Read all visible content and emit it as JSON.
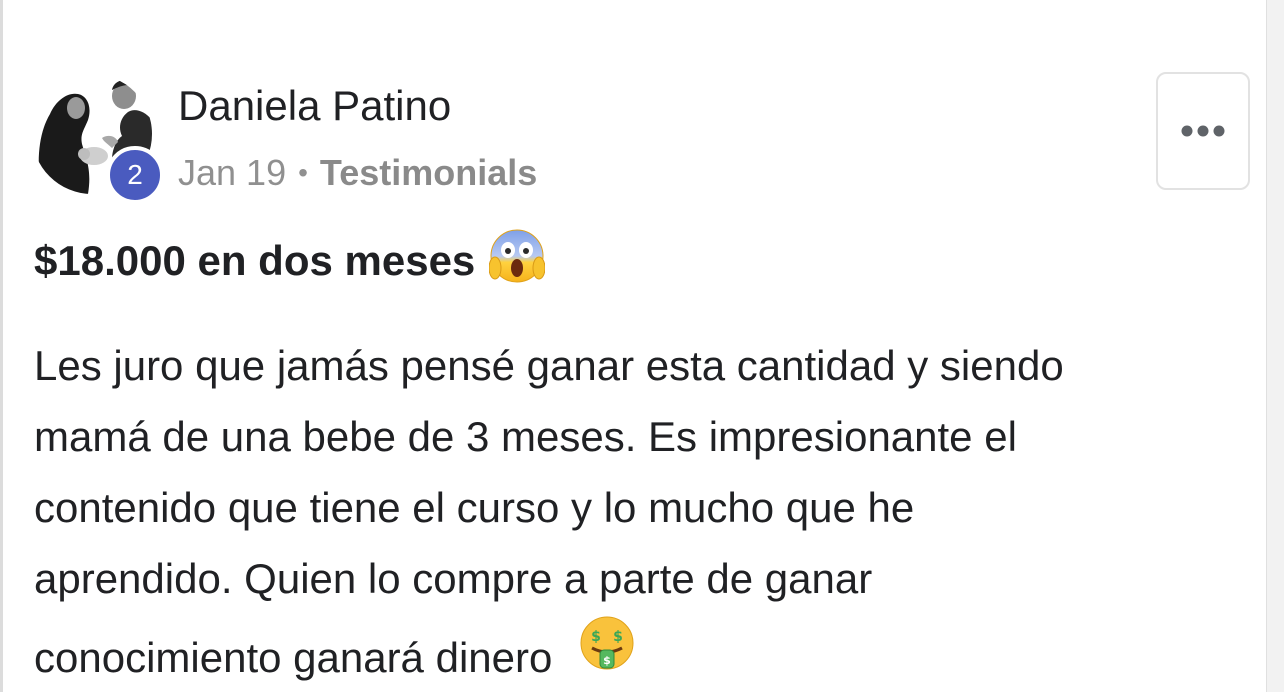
{
  "post": {
    "author": {
      "name": "Daniela Patino",
      "level": "2"
    },
    "meta": {
      "date": "Jan 19",
      "separator": "•",
      "category": "Testimonials"
    },
    "title": "$18.000 en dos meses",
    "title_emoji": "face-screaming-in-fear",
    "body_lines": [
      "Les juro que jamás pensé ganar esta cantidad y siendo",
      "mamá de una bebe de 3 meses. Es impresionante el",
      "contenido que tiene el curso y lo mucho que he",
      "aprendido. Quien lo compre a parte de ganar",
      "conocimiento ganará dinero"
    ],
    "body_end_emoji": "money-mouth-face"
  },
  "icons": {
    "more": "more-horizontal-icon"
  },
  "colors": {
    "badge": "#4a5bbf",
    "text": "#202124",
    "muted": "#909090"
  }
}
